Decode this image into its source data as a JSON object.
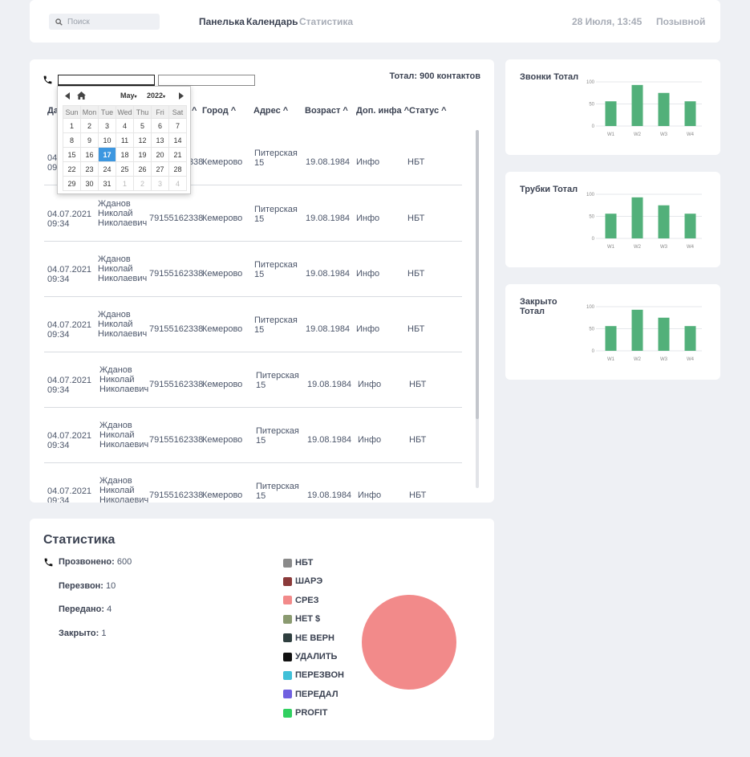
{
  "header": {
    "search_placeholder": "Поиск",
    "nav": [
      "Панелька",
      "Календарь",
      "Статистика"
    ],
    "datetime": "28 Июля, 13:45",
    "callsign": "Позывной"
  },
  "contacts": {
    "total": "Тотал: 900 контактов",
    "columns": [
      "Да",
      "^",
      "Город ^",
      "Адрес ^",
      "Возраст ^",
      "Доп. инфа ^",
      "Статус ^"
    ],
    "rows": [
      {
        "date": "04.07.2021",
        "time": "09:34",
        "name1": "Жданов",
        "name2": "Николай",
        "name3": "Николаевич",
        "phone": "79155162338",
        "city": "Кемерово",
        "addr1": "Питерская",
        "addr2": "15",
        "age": "19.08.1984",
        "info": "Инфо",
        "status": "НБТ"
      },
      {
        "date": "04.07.2021",
        "time": "09:34",
        "name1": "Жданов",
        "name2": "Николай",
        "name3": "Николаевич",
        "phone": "79155162338",
        "city": "Кемерово",
        "addr1": "Питерская",
        "addr2": "15",
        "age": "19.08.1984",
        "info": "Инфо",
        "status": "НБТ"
      },
      {
        "date": "04.07.2021",
        "time": "09:34",
        "name1": "Жданов",
        "name2": "Николай",
        "name3": "Николаевич",
        "phone": "79155162338",
        "city": "Кемерово",
        "addr1": "Питерская",
        "addr2": "15",
        "age": "19.08.1984",
        "info": "Инфо",
        "status": "НБТ"
      },
      {
        "date": "04.07.2021",
        "time": "09:34",
        "name1": "Жданов",
        "name2": "Николай",
        "name3": "Николаевич",
        "phone": "79155162338",
        "city": "Кемерово",
        "addr1": "Питерская",
        "addr2": "15",
        "age": "19.08.1984",
        "info": "Инфо",
        "status": "НБТ"
      },
      {
        "date": "04.07.2021",
        "time": "09:34",
        "name1": "Жданов",
        "name2": "Николай",
        "name3": "Николаевич",
        "phone": "79155162338",
        "city": "Кемерово",
        "addr1": "Питерская",
        "addr2": "15",
        "age": "19.08.1984",
        "info": "Инфо",
        "status": "НБТ"
      },
      {
        "date": "04.07.2021",
        "time": "09:34",
        "name1": "Жданов",
        "name2": "Николай",
        "name3": "Николаевич",
        "phone": "79155162338",
        "city": "Кемерово",
        "addr1": "Питерская",
        "addr2": "15",
        "age": "19.08.1984",
        "info": "Инфо",
        "status": "НБТ"
      },
      {
        "date": "04.07.2021",
        "time": "09:34",
        "name1": "Жданов",
        "name2": "Николай",
        "name3": "Николаевич",
        "phone": "79155162338",
        "city": "Кемерово",
        "addr1": "Питерская",
        "addr2": "15",
        "age": "19.08.1984",
        "info": "Инфо",
        "status": "НБТ"
      }
    ]
  },
  "datepicker": {
    "month": "May",
    "year": "2022",
    "weekdays": [
      "Sun",
      "Mon",
      "Tue",
      "Wed",
      "Thu",
      "Fri",
      "Sat"
    ],
    "weeks": [
      [
        "1",
        "2",
        "3",
        "4",
        "5",
        "6",
        "7"
      ],
      [
        "8",
        "9",
        "10",
        "11",
        "12",
        "13",
        "14"
      ],
      [
        "15",
        "16",
        "17",
        "18",
        "19",
        "20",
        "21"
      ],
      [
        "22",
        "23",
        "24",
        "25",
        "26",
        "27",
        "28"
      ],
      [
        "29",
        "30",
        "31",
        "1",
        "2",
        "3",
        "4"
      ]
    ],
    "selected": "17"
  },
  "charts": [
    {
      "title": "Звонки Тотал"
    },
    {
      "title": "Трубки Тотал"
    },
    {
      "title": "Закрыто Тотал"
    }
  ],
  "chart_data": [
    {
      "type": "bar",
      "title": "Звонки Тотал",
      "categories": [
        "W1",
        "W2",
        "W3",
        "W4"
      ],
      "values": [
        56,
        93,
        75,
        56
      ],
      "ylim": [
        0,
        100
      ],
      "yticks": [
        "0",
        "50",
        "100"
      ],
      "color": "#52b07a"
    },
    {
      "type": "bar",
      "title": "Трубки Тотал",
      "categories": [
        "W1",
        "W2",
        "W3",
        "W4"
      ],
      "values": [
        56,
        93,
        75,
        56
      ],
      "ylim": [
        0,
        100
      ],
      "yticks": [
        "0",
        "50",
        "100"
      ],
      "color": "#52b07a"
    },
    {
      "type": "bar",
      "title": "Закрыто Тотал",
      "categories": [
        "W1",
        "W2",
        "W3",
        "W4"
      ],
      "values": [
        56,
        93,
        75,
        56
      ],
      "ylim": [
        0,
        100
      ],
      "yticks": [
        "0",
        "50",
        "100"
      ],
      "color": "#52b07a"
    }
  ],
  "stats": {
    "title": "Статистика",
    "items": [
      {
        "label": "Прозвонено:",
        "value": "600"
      },
      {
        "label": "Перезвон:",
        "value": "10"
      },
      {
        "label": "Передано:",
        "value": "4"
      },
      {
        "label": "Закрыто:",
        "value": "1"
      }
    ],
    "legend": [
      {
        "label": "НБТ",
        "color": "#8a8a8a"
      },
      {
        "label": "ШАРЭ",
        "color": "#8b3a3a"
      },
      {
        "label": "СРЕЗ",
        "color": "#f28a8a"
      },
      {
        "label": "НЕТ $",
        "color": "#8a9a70"
      },
      {
        "label": "НЕ ВЕРН",
        "color": "#2f3f3f"
      },
      {
        "label": "УДАЛИТЬ",
        "color": "#111111"
      },
      {
        "label": "ПЕРЕЗВОН",
        "color": "#40c0d8"
      },
      {
        "label": "ПЕРЕДАЛ",
        "color": "#7060e0"
      },
      {
        "label": "PROFIT",
        "color": "#30d060"
      }
    ],
    "pie_color": "#f28a8a"
  }
}
